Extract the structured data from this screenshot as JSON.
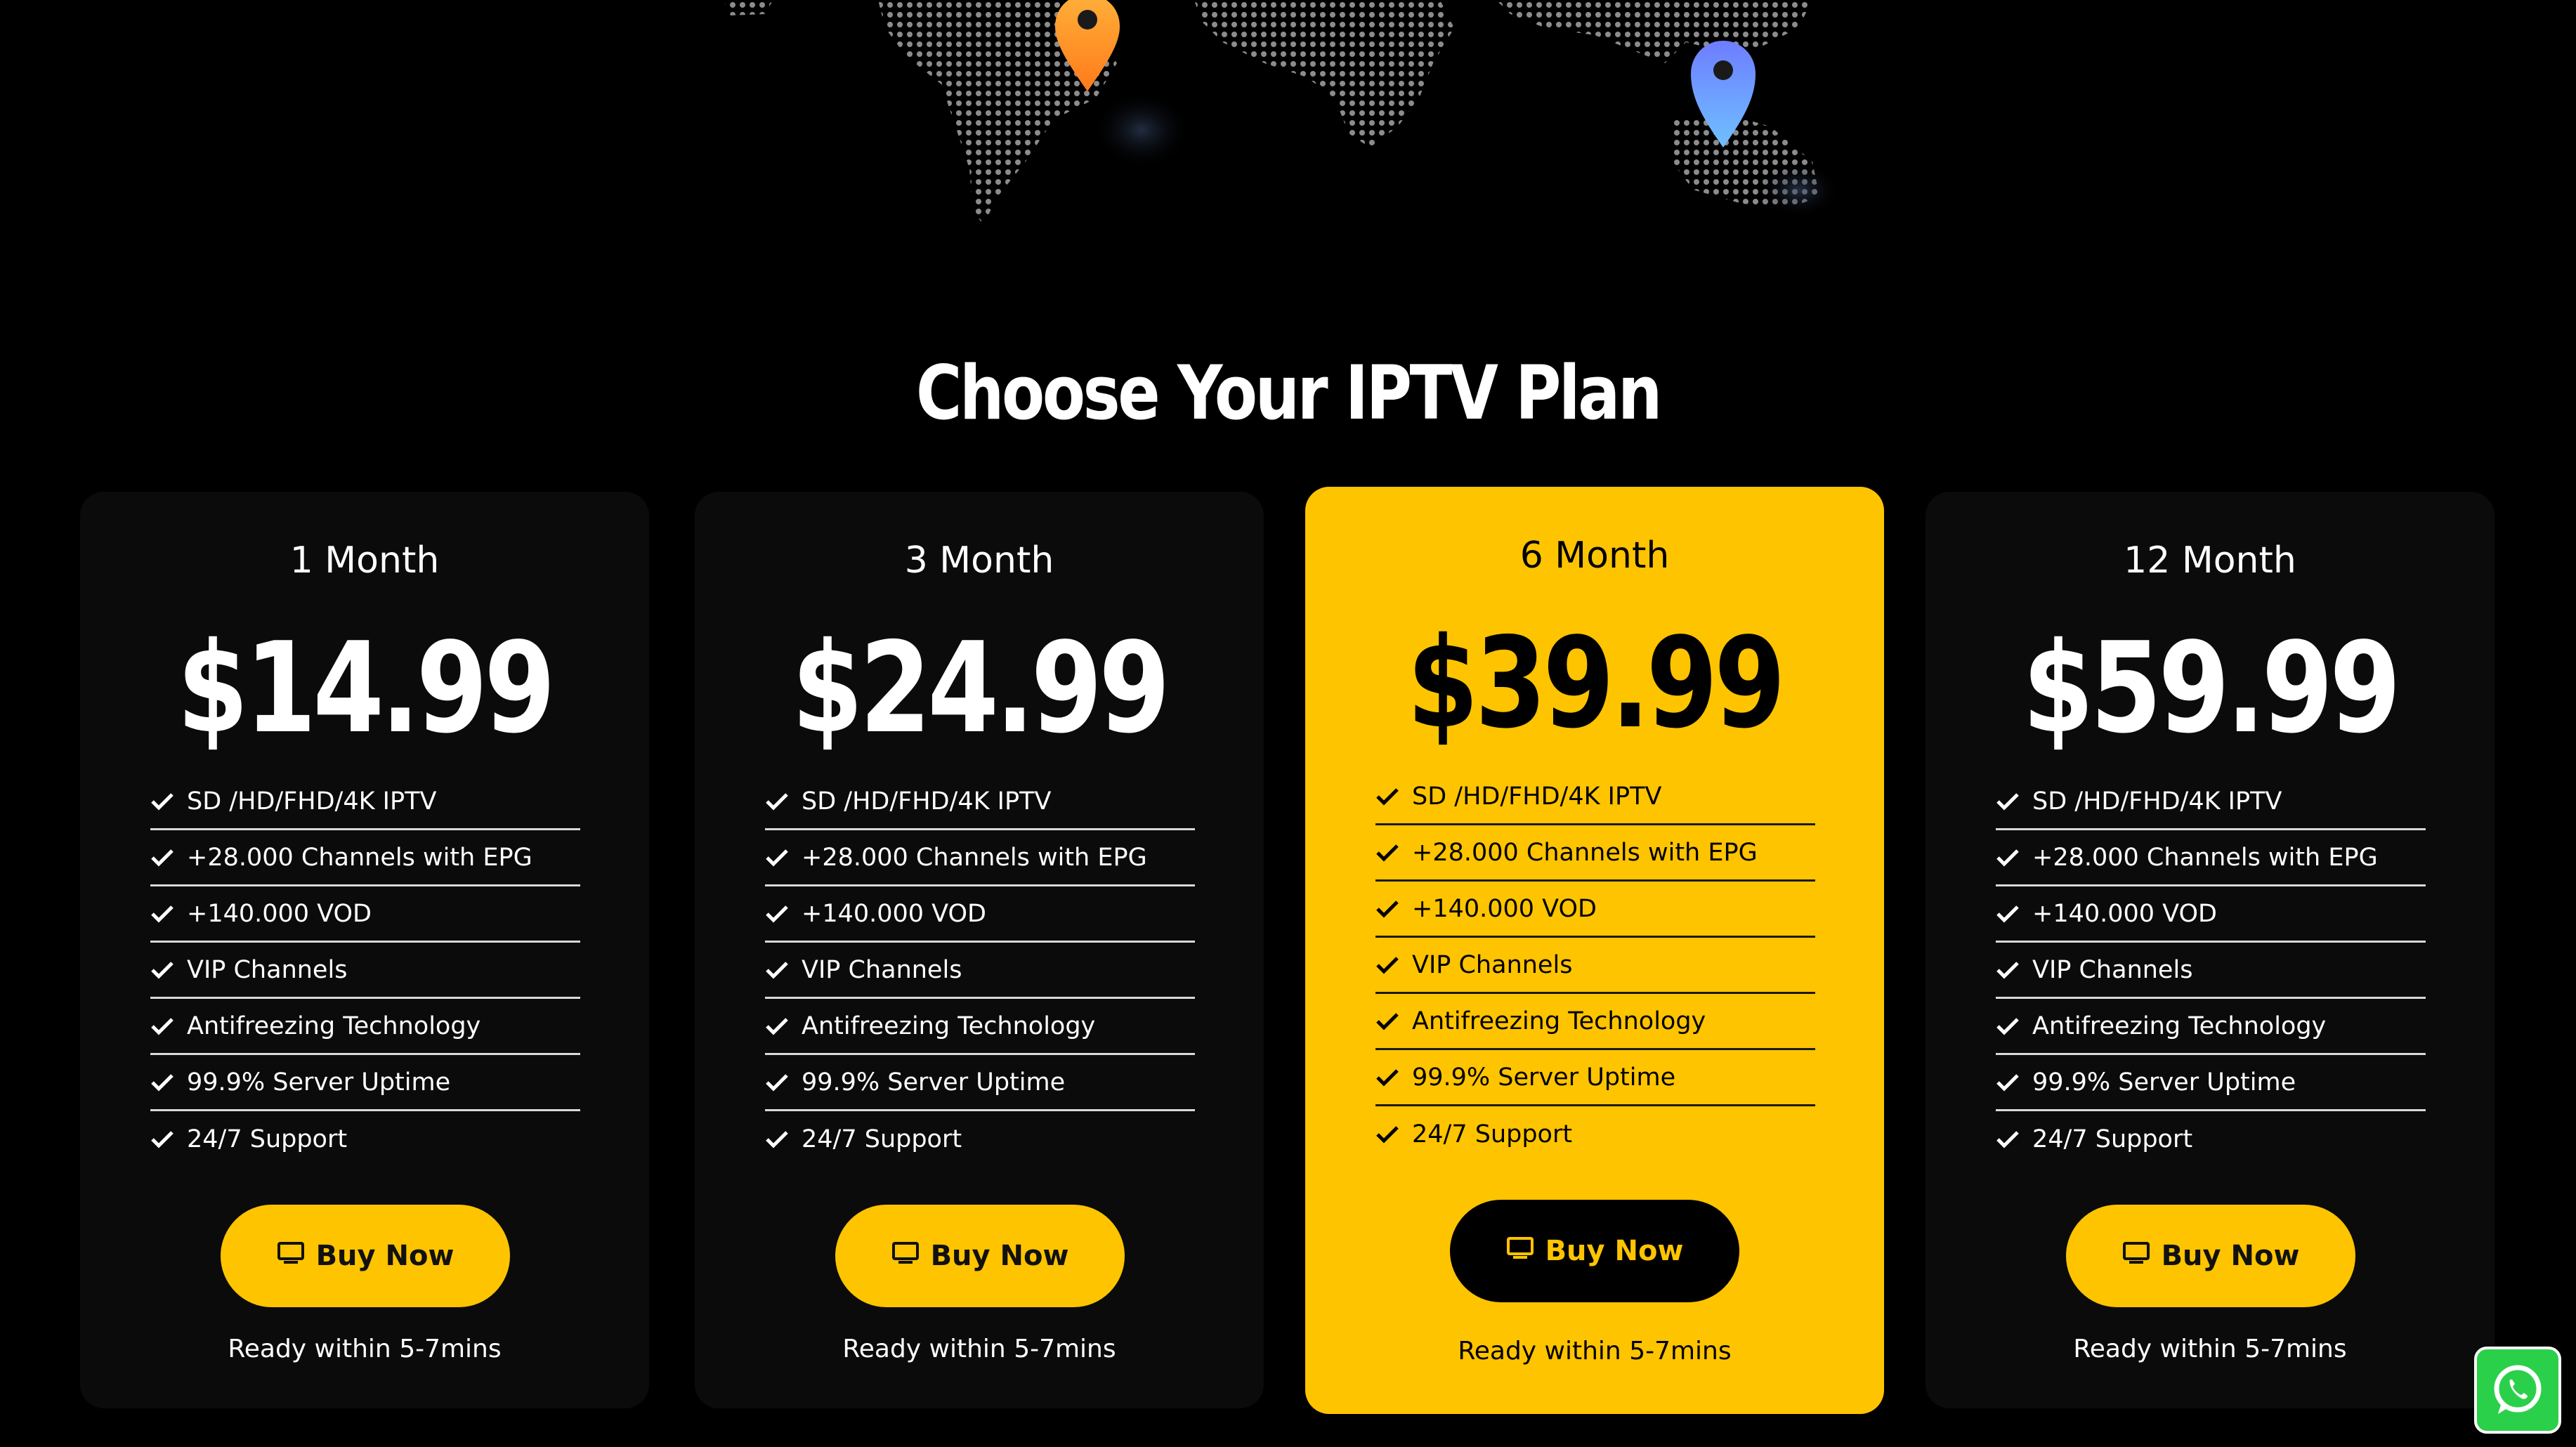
{
  "heading": "Choose Your IPTV Plan",
  "accent_color": "#ffc400",
  "plans": [
    {
      "name": "1 Month",
      "price": "$14.99",
      "featured": false,
      "features": [
        "SD /HD/FHD/4K IPTV",
        "+28.000 Channels with EPG",
        "+140.000 VOD",
        "VIP Channels",
        "Antifreezing Technology",
        "99.9% Server Uptime",
        "24/7 Support"
      ],
      "button_label": "Buy Now",
      "note": "Ready within 5-7mins"
    },
    {
      "name": "3 Month",
      "price": "$24.99",
      "featured": false,
      "features": [
        "SD /HD/FHD/4K IPTV",
        "+28.000 Channels with EPG",
        "+140.000 VOD",
        "VIP Channels",
        "Antifreezing Technology",
        "99.9% Server Uptime",
        "24/7 Support"
      ],
      "button_label": "Buy Now",
      "note": "Ready within 5-7mins"
    },
    {
      "name": "6 Month",
      "price": "$39.99",
      "featured": true,
      "features": [
        "SD /HD/FHD/4K IPTV",
        "+28.000 Channels with EPG",
        "+140.000 VOD",
        "VIP Channels",
        "Antifreezing Technology",
        "99.9% Server Uptime",
        "24/7 Support"
      ],
      "button_label": "Buy Now",
      "note": "Ready within 5-7mins"
    },
    {
      "name": "12 Month",
      "price": "$59.99",
      "featured": false,
      "features": [
        "SD /HD/FHD/4K IPTV",
        "+28.000 Channels with EPG",
        "+140.000 VOD",
        "VIP Channels",
        "Antifreezing Technology",
        "99.9% Server Uptime",
        "24/7 Support"
      ],
      "button_label": "Buy Now",
      "note": "Ready within 5-7mins"
    }
  ],
  "icons": {
    "check": "check-icon",
    "button": "monitor-icon",
    "floating": "whatsapp-icon",
    "map_pins": [
      "location-pin-orange",
      "location-pin-blue"
    ]
  }
}
